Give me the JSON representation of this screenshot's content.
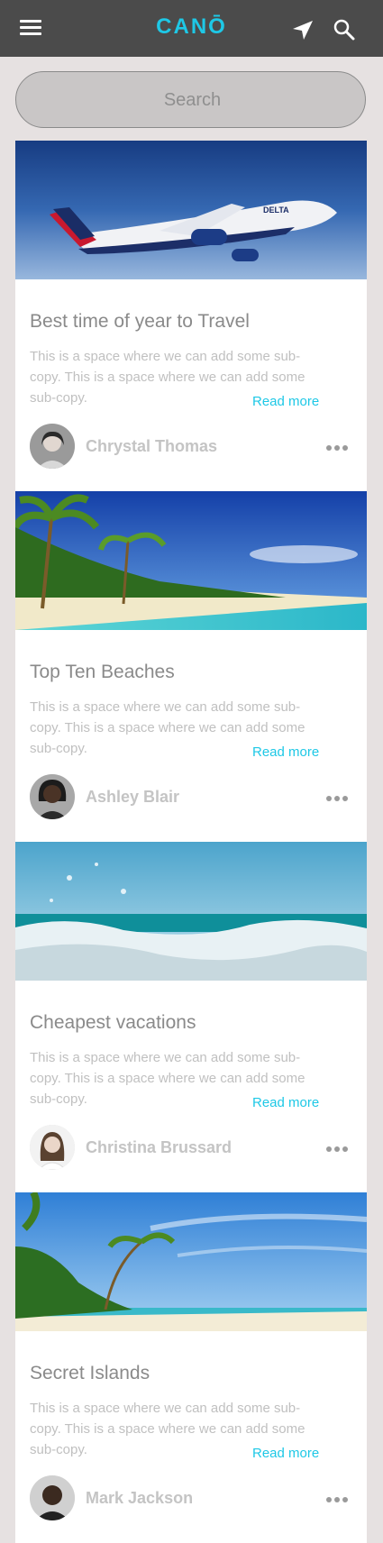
{
  "app": {
    "logo_text": "CANŌ",
    "accent_color": "#1ec8e6",
    "header_icons": [
      "menu-icon",
      "location-arrow-icon",
      "search-icon"
    ]
  },
  "search": {
    "placeholder": "Search",
    "value": ""
  },
  "articles": [
    {
      "image": "airplane-photo",
      "title": "Best time of year to Travel",
      "body": "This is a space where we can add some sub-copy. This is a space where we can add some sub-copy.",
      "read_more": "Read more",
      "author": "Chrystal Thomas"
    },
    {
      "image": "palm-beach-photo",
      "title": "Top Ten Beaches",
      "body": "This is a space where we can add some sub-copy. This is a space where we can add some sub-copy.",
      "read_more": "Read more",
      "author": "Ashley Blair"
    },
    {
      "image": "ocean-wave-photo",
      "title": "Cheapest vacations",
      "body": "This is a space where we can add some sub-copy. This is a space where we can add some sub-copy.",
      "read_more": "Read more",
      "author": "Christina Brussard"
    },
    {
      "image": "island-shore-photo",
      "title": "Secret Islands",
      "body": "This is a space where we can add some sub-copy. This is a space where we can add some sub-copy.",
      "read_more": "Read more",
      "author": "Mark Jackson"
    }
  ]
}
